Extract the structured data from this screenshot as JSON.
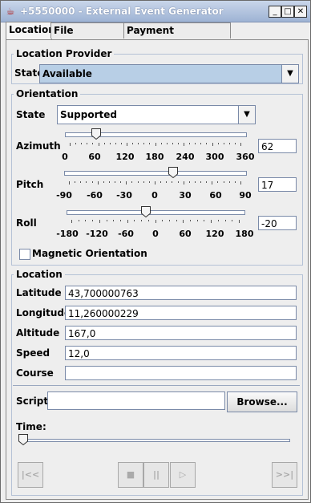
{
  "window": {
    "title": "+5550000 - External Event Generator",
    "app_icon": "java-cup-icon"
  },
  "tabs": [
    "Location",
    "File Connection",
    "Payment Transactions"
  ],
  "location_provider": {
    "title": "Location Provider",
    "state_label": "State",
    "state_value": "Available"
  },
  "orientation": {
    "title": "Orientation",
    "state_label": "State",
    "state_value": "Supported",
    "azimuth": {
      "label": "Azimuth",
      "value": "62",
      "ticks": [
        "0",
        "60",
        "120",
        "180",
        "240",
        "300",
        "360"
      ]
    },
    "pitch": {
      "label": "Pitch",
      "value": "17",
      "ticks": [
        "-90",
        "-60",
        "-30",
        "0",
        "30",
        "60",
        "90"
      ]
    },
    "roll": {
      "label": "Roll",
      "value": "-20",
      "ticks": [
        "-180",
        "-120",
        "-60",
        "0",
        "60",
        "120",
        "180"
      ]
    },
    "magnetic_label": "Magnetic Orientation"
  },
  "location": {
    "title": "Location",
    "latitude_label": "Latitude",
    "latitude": "43,700000763",
    "longitude_label": "Longitude",
    "longitude": "11,260000229",
    "altitude_label": "Altitude",
    "altitude": "167,0",
    "speed_label": "Speed",
    "speed": "12,0",
    "course_label": "Course",
    "course": ""
  },
  "script": {
    "label": "Script",
    "value": "",
    "browse": "Browse..."
  },
  "time": {
    "label": "Time:"
  },
  "media": {
    "rewind": "|<<",
    "stop": "■",
    "pause": "||",
    "play": "▷",
    "end": ">>|"
  }
}
